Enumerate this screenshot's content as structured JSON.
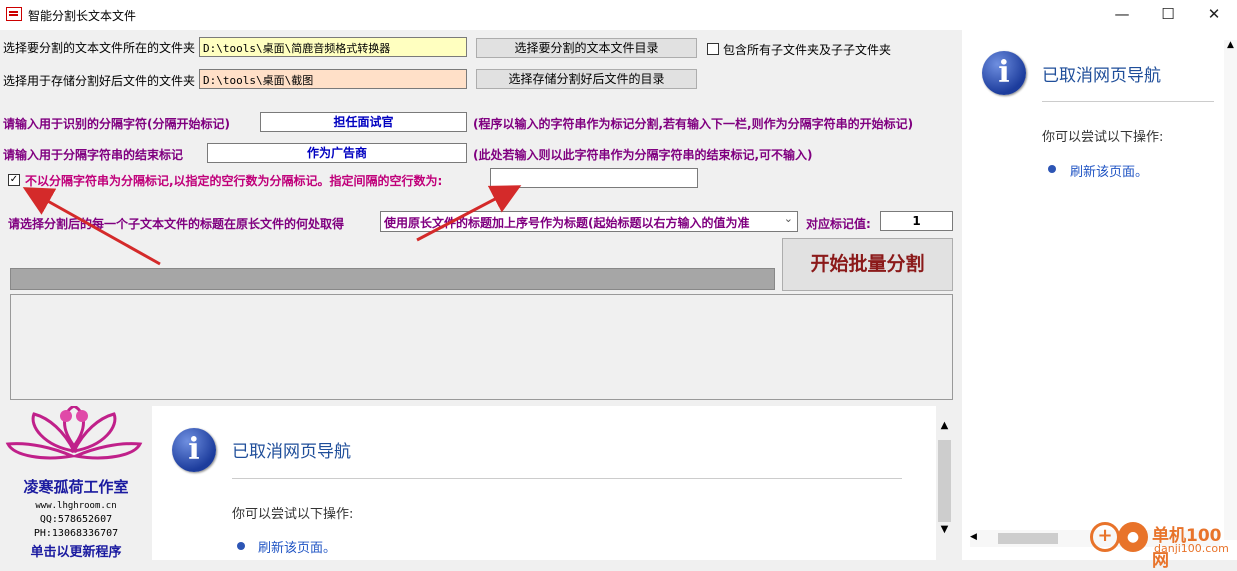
{
  "window": {
    "title": "智能分割长文本文件",
    "minimize_glyph": "—",
    "maximize_glyph": "☐",
    "close_glyph": "✕"
  },
  "source_folder": {
    "label": "选择要分割的文本文件所在的文件夹",
    "value": "D:\\tools\\桌面\\简鹿音频格式转换器",
    "button": "选择要分割的文本文件目录",
    "include_subfolders_label": "包含所有子文件夹及子子文件夹",
    "include_subfolders_checked": false
  },
  "output_folder": {
    "label": "选择用于存储分割好后文件的文件夹",
    "value": "D:\\tools\\桌面\\截图",
    "button": "选择存储分割好后文件的目录"
  },
  "start_marker": {
    "label": "请输入用于识别的分隔字符(分隔开始标记)",
    "value": "担任面试官",
    "hint": "(程序以输入的字符串作为标记分割,若有输入下一栏,则作为分隔字符串的开始标记)"
  },
  "end_marker": {
    "label": "请输入用于分隔字符串的结束标记",
    "value": "作为广告商",
    "hint": "(此处若输入则以此字符串作为分隔字符串的结束标记,可不输入)"
  },
  "blank_lines_option": {
    "checked": true,
    "check_glyph": "✓",
    "label": "不以分隔字符串为分隔标记,以指定的空行数为分隔标记。指定间隔的空行数为:",
    "value": ""
  },
  "title_source": {
    "label": "请选择分割后的每一个子文本文件的标题在原长文件的何处取得",
    "selected": "使用原长文件的标题加上序号作为标题(起始标题以右方输入的值为准",
    "counter_label": "对应标记值:",
    "counter_value": "1"
  },
  "start_button": "开始批量分割",
  "progress": 0,
  "logo": {
    "studio_name": "凌寒孤荷工作室",
    "site": "www.lhghroom.cn",
    "qq": "QQ:578652607",
    "phone": "PH:13068336707",
    "update_link": "单击以更新程序",
    "accent_color": "#c0208a"
  },
  "nav_error": {
    "title": "已取消网页导航",
    "suggest": "你可以尝试以下操作:",
    "action": "刷新该页面。",
    "icon": "info-icon"
  },
  "watermark": {
    "site_cn": "单机100网",
    "site_url": "danji100.com",
    "color": "#e8732a"
  },
  "arrow_color": "#d42a2a"
}
